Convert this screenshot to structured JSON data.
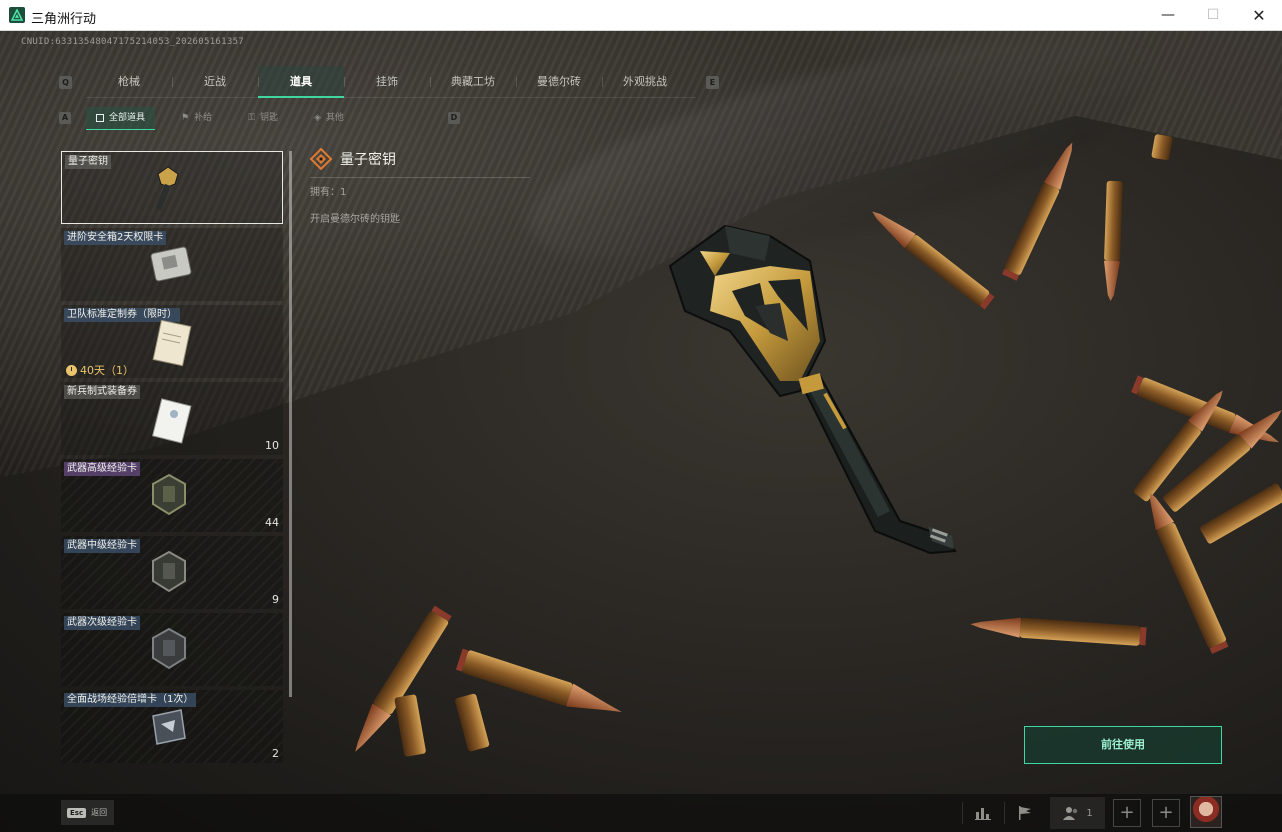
{
  "window": {
    "title": "三角洲行动",
    "minimize": "—",
    "maximize": "☐",
    "close": "✕"
  },
  "uid": "CNUID:63313548047175214053_202605161357",
  "category_tabs": {
    "prev_key": "Q",
    "next_key": "E",
    "items": [
      {
        "label": "枪械"
      },
      {
        "label": "近战"
      },
      {
        "label": "道具"
      },
      {
        "label": "挂饰"
      },
      {
        "label": "典藏工坊"
      },
      {
        "label": "曼德尔砖"
      },
      {
        "label": "外观挑战"
      }
    ],
    "active_index": 2
  },
  "sub_tabs": {
    "prev_key": "A",
    "next_key": "D",
    "items": [
      {
        "label": "全部道具"
      },
      {
        "label": "补给"
      },
      {
        "label": "钥匙"
      },
      {
        "label": "其他"
      }
    ],
    "active_index": 0
  },
  "items": [
    {
      "name": "量子密钥",
      "rarity": "gray",
      "count": "",
      "selected": true
    },
    {
      "name": "进阶安全箱2天权限卡",
      "rarity": "blue",
      "count": ""
    },
    {
      "name": "卫队标准定制券（限时）",
      "rarity": "blue",
      "count": "",
      "timer": "40天（1）"
    },
    {
      "name": "新兵制式装备券",
      "rarity": "gray",
      "count": "10"
    },
    {
      "name": "武器高级经验卡",
      "rarity": "purple",
      "count": "44"
    },
    {
      "name": "武器中级经验卡",
      "rarity": "blue",
      "count": "9"
    },
    {
      "name": "武器次级经验卡",
      "rarity": "blue",
      "count": ""
    },
    {
      "name": "全面战场经验倍增卡（1次）",
      "rarity": "blue",
      "count": "2"
    }
  ],
  "detail": {
    "title": "量子密钥",
    "own": "拥有：1",
    "description": "开启曼德尔砖的钥匙"
  },
  "action": {
    "use_label": "前往使用"
  },
  "bottom_bar": {
    "esc_key": "Esc",
    "esc_label": "返回",
    "friends_count": "1"
  },
  "colors": {
    "accent": "#3fd6a0",
    "timer": "#e9c46a",
    "rarity_gray": "#6e6e69",
    "rarity_blue": "#3c5069",
    "rarity_purple": "#5f4678"
  },
  "icons": {
    "app": "delta-force-logo-icon",
    "detail": "key-category-icon",
    "stats": "bar-chart-icon",
    "flag": "flag-icon",
    "friends": "friends-icon"
  }
}
